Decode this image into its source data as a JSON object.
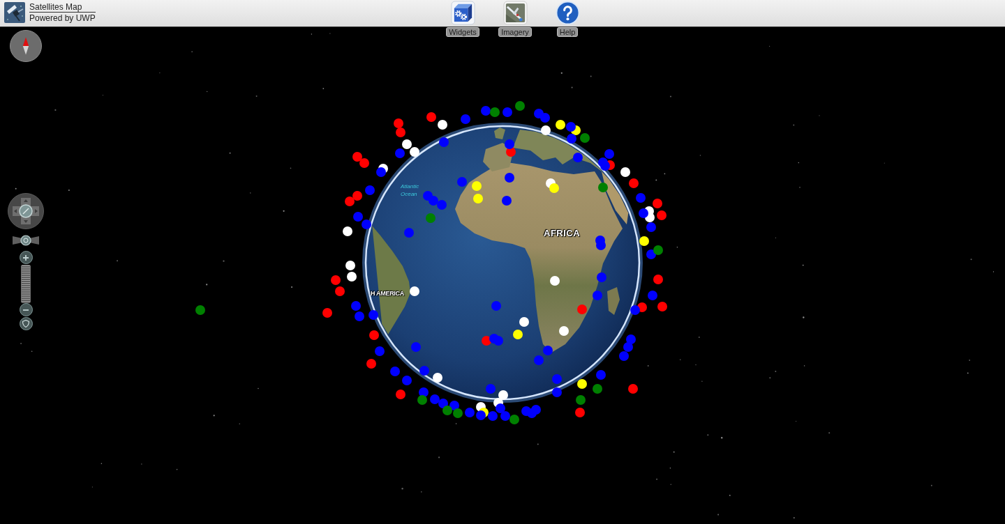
{
  "app": {
    "title": "Satellites Map",
    "subtitle": "Powered by UWP"
  },
  "toolbar": [
    {
      "kind": "widgets",
      "label": "Widgets"
    },
    {
      "kind": "imagery",
      "label": "Imagery"
    },
    {
      "kind": "help",
      "label": "Help"
    }
  ],
  "map_labels": [
    {
      "kind": "ocean",
      "text": "Atlantic Ocean"
    },
    {
      "kind": "continent",
      "text": "AFRICA"
    },
    {
      "kind": "continent",
      "text": "H AMERICA"
    }
  ],
  "satellite_groups": [
    {
      "color": "#ff0000"
    },
    {
      "color": "#ffffff"
    },
    {
      "color": "#ffff00"
    },
    {
      "color": "#0000ff"
    },
    {
      "color": "#008000"
    }
  ]
}
